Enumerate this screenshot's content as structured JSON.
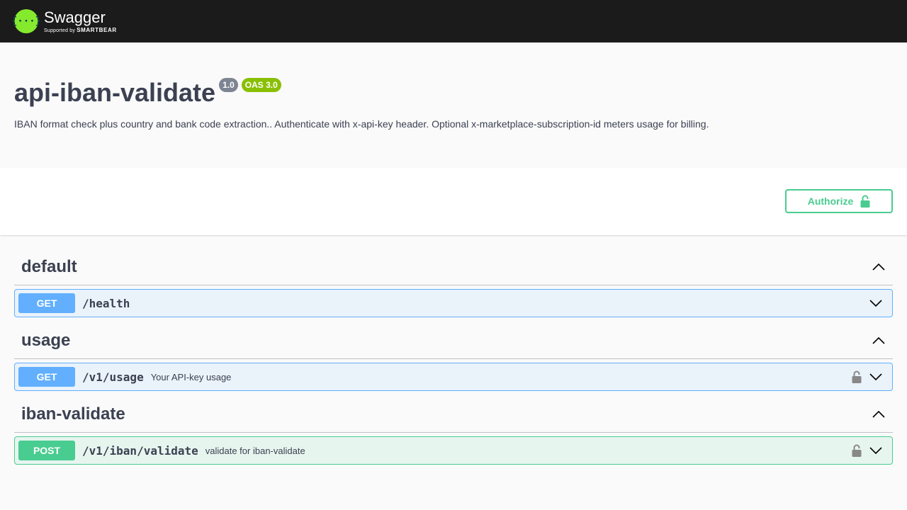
{
  "header": {
    "brand_name": "Swagger",
    "brand_sub_prefix": "Supported by",
    "brand_sub_company": "SMARTBEAR",
    "logo_glyph": "{···}"
  },
  "info": {
    "title": "api-iban-validate",
    "version": "1.0",
    "oas": "OAS 3.0",
    "description": "IBAN format check plus country and bank code extraction.. Authenticate with x-api-key header. Optional x-marketplace-subscription-id meters usage for billing."
  },
  "authorize": {
    "label": "Authorize",
    "icon": "unlock-icon"
  },
  "tags": [
    {
      "name": "default",
      "operations": [
        {
          "method": "GET",
          "path": "/health",
          "summary": "",
          "locked": false
        }
      ]
    },
    {
      "name": "usage",
      "operations": [
        {
          "method": "GET",
          "path": "/v1/usage",
          "summary": "Your API-key usage",
          "locked": true
        }
      ]
    },
    {
      "name": "iban-validate",
      "operations": [
        {
          "method": "POST",
          "path": "/v1/iban/validate",
          "summary": "validate for iban-validate",
          "locked": true
        }
      ]
    }
  ],
  "colors": {
    "get": "#61affe",
    "post": "#49cc90",
    "topbar": "#1b1b1b",
    "logo": "#85ea2d",
    "badge_version": "#7d8492",
    "badge_oas": "#89bf04"
  }
}
